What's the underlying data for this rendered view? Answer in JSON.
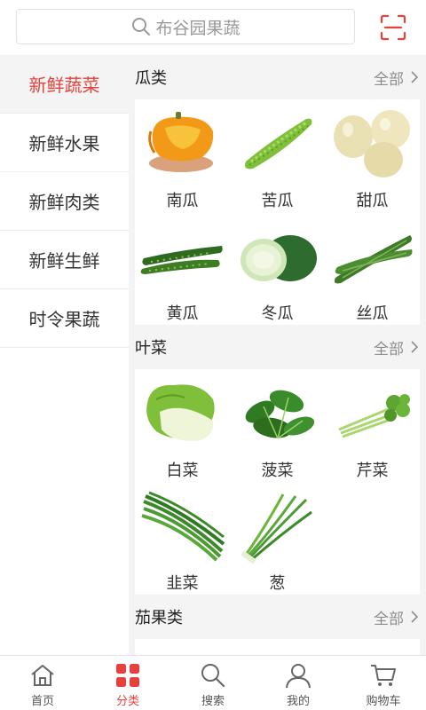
{
  "search": {
    "placeholder": "布谷园果蔬"
  },
  "colors": {
    "accent": "#e8413d",
    "text": "#333333",
    "muted": "#8d8d8d"
  },
  "sidebar": {
    "items": [
      {
        "label": "新鲜蔬菜",
        "active": true
      },
      {
        "label": "新鲜水果",
        "active": false
      },
      {
        "label": "新鲜肉类",
        "active": false
      },
      {
        "label": "新鲜生鲜",
        "active": false
      },
      {
        "label": "时令果蔬",
        "active": false
      }
    ]
  },
  "sections": [
    {
      "title": "瓜类",
      "more": "全部",
      "items": [
        {
          "name": "南瓜",
          "icon": "pumpkin-image"
        },
        {
          "name": "苦瓜",
          "icon": "bitter-melon-image"
        },
        {
          "name": "甜瓜",
          "icon": "sweet-melon-image"
        },
        {
          "name": "黄瓜",
          "icon": "cucumber-image"
        },
        {
          "name": "冬瓜",
          "icon": "winter-melon-image"
        },
        {
          "name": "丝瓜",
          "icon": "luffa-image"
        }
      ]
    },
    {
      "title": "叶菜",
      "more": "全部",
      "items": [
        {
          "name": "白菜",
          "icon": "cabbage-image"
        },
        {
          "name": "菠菜",
          "icon": "spinach-image"
        },
        {
          "name": "芹菜",
          "icon": "celery-image"
        },
        {
          "name": "韭菜",
          "icon": "chives-image"
        },
        {
          "name": "葱",
          "icon": "scallion-image"
        }
      ]
    },
    {
      "title": "茄果类",
      "more": "全部",
      "items": []
    }
  ],
  "tabbar": {
    "items": [
      {
        "label": "首页",
        "icon": "home-icon",
        "active": false
      },
      {
        "label": "分类",
        "icon": "category-icon",
        "active": true
      },
      {
        "label": "搜索",
        "icon": "search-icon",
        "active": false
      },
      {
        "label": "我的",
        "icon": "user-icon",
        "active": false
      },
      {
        "label": "购物车",
        "icon": "cart-icon",
        "active": false
      }
    ]
  }
}
